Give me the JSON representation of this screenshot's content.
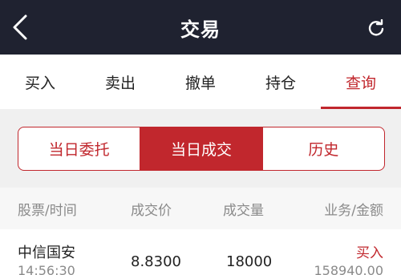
{
  "header": {
    "title": "交易",
    "back_icon": "chevron-left-icon",
    "refresh_icon": "refresh-icon"
  },
  "tabs": [
    {
      "label": "买入",
      "active": false
    },
    {
      "label": "卖出",
      "active": false
    },
    {
      "label": "撤单",
      "active": false
    },
    {
      "label": "持仓",
      "active": false
    },
    {
      "label": "查询",
      "active": true
    }
  ],
  "segments": [
    {
      "label": "当日委托",
      "active": false
    },
    {
      "label": "当日成交",
      "active": true
    },
    {
      "label": "历史",
      "active": false
    }
  ],
  "table": {
    "headers": [
      "股票/时间",
      "成交价",
      "成交量",
      "业务/金额"
    ],
    "rows": [
      {
        "name": "中信国安",
        "time": "14:56:30",
        "price": "8.8300",
        "volume": "18000",
        "side": "买入",
        "amount": "158940.00"
      }
    ]
  },
  "colors": {
    "accent": "#c1272d",
    "titlebar": "#1f2230",
    "muted_text": "#8a8a8a",
    "panel_bg": "#f0f0f0"
  }
}
